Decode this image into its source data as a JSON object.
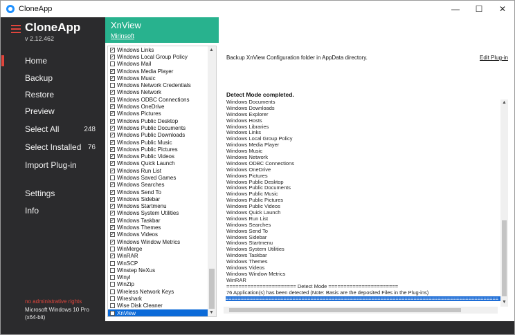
{
  "window": {
    "title": "CloneApp",
    "controls": {
      "minimize": "—",
      "maximize": "☐",
      "close": "✕"
    }
  },
  "sidebar": {
    "brand": "CloneApp",
    "version": "v 2.12.462",
    "items": [
      {
        "label": "Home",
        "count": ""
      },
      {
        "label": "Backup",
        "count": ""
      },
      {
        "label": "Restore",
        "count": ""
      },
      {
        "label": "Preview",
        "count": ""
      },
      {
        "label": "Select All",
        "count": "248"
      },
      {
        "label": "Select Installed",
        "count": "76"
      },
      {
        "label": "Import Plug-in",
        "count": ""
      },
      {
        "label": "Settings",
        "count": ""
      },
      {
        "label": "Info",
        "count": ""
      }
    ],
    "admin_note": "no administrative rights",
    "os_info": "Microsoft Windows 10 Pro (x64-bit)"
  },
  "plugin": {
    "title": "XnView",
    "author": "Mirinsoft",
    "description": "Backup XnView Configuration folder in AppData directory.",
    "edit_link": "Edit Plug-in"
  },
  "plugin_list": [
    {
      "label": "Windows Links",
      "checked": true
    },
    {
      "label": "Windows Local Group Policy",
      "checked": true
    },
    {
      "label": "Windows Mail",
      "checked": false
    },
    {
      "label": "Windows Media Player",
      "checked": true
    },
    {
      "label": "Windows Music",
      "checked": true
    },
    {
      "label": "Windows Network Credentials",
      "checked": false
    },
    {
      "label": "Windows Network",
      "checked": true
    },
    {
      "label": "Windows ODBC Connections",
      "checked": true
    },
    {
      "label": "Windows OneDrive",
      "checked": true
    },
    {
      "label": "Windows Pictures",
      "checked": true
    },
    {
      "label": "Windows Public Desktop",
      "checked": true
    },
    {
      "label": "Windows Public Documents",
      "checked": true
    },
    {
      "label": "Windows Public Downloads",
      "checked": true
    },
    {
      "label": "Windows Public Music",
      "checked": true
    },
    {
      "label": "Windows Public Pictures",
      "checked": true
    },
    {
      "label": "Windows Public Videos",
      "checked": true
    },
    {
      "label": "Windows Quick Launch",
      "checked": true
    },
    {
      "label": "Windows Run List",
      "checked": true
    },
    {
      "label": "Windows Saved Games",
      "checked": false
    },
    {
      "label": "Windows Searches",
      "checked": true
    },
    {
      "label": "Windows Send To",
      "checked": true
    },
    {
      "label": "Windows Sidebar",
      "checked": true
    },
    {
      "label": "Windows Startmenu",
      "checked": true
    },
    {
      "label": "Windows System Utilities",
      "checked": true
    },
    {
      "label": "Windows Taskbar",
      "checked": true
    },
    {
      "label": "Windows Themes",
      "checked": true
    },
    {
      "label": "Windows Videos",
      "checked": true
    },
    {
      "label": "Windows Window Metrics",
      "checked": true
    },
    {
      "label": "WinMerge",
      "checked": false
    },
    {
      "label": "WinRAR",
      "checked": true
    },
    {
      "label": "WinSCP",
      "checked": false
    },
    {
      "label": "Winstep NeXus",
      "checked": false
    },
    {
      "label": "Winyl",
      "checked": false
    },
    {
      "label": "WinZip",
      "checked": false
    },
    {
      "label": "Wireless Network Keys",
      "checked": false
    },
    {
      "label": "Wireshark",
      "checked": false
    },
    {
      "label": "Wise Disk Cleaner",
      "checked": false
    },
    {
      "label": "XnView",
      "checked": false,
      "selected": true
    }
  ],
  "log": {
    "title": "Detect Mode completed.",
    "lines": [
      "Windows Documents",
      "Windows Downloads",
      "Windows Explorer",
      "Windows Hosts",
      "Windows Libraries",
      "Windows Links",
      "Windows Local Group Policy",
      "Windows Media Player",
      "Windows Music",
      "Windows Network",
      "Windows ODBC Connections",
      "Windows OneDrive",
      "Windows Pictures",
      "Windows Public Desktop",
      "Windows Public Documents",
      "Windows Public Music",
      "Windows Public Pictures",
      "Windows Public Videos",
      "Windows Quick Launch",
      "Windows Run List",
      "Windows Searches",
      "Windows Send To",
      "Windows Sidebar",
      "Windows Startmenu",
      "Windows System Utilities",
      "Windows Taskbar",
      "Windows Themes",
      "Windows Videos",
      "Windows Window Metrics",
      "WinRAR",
      "======================= Detect Mode =======================",
      "76 Application(s) has been detected (Note: Basis are the deposited Files in the Plug-ins)",
      "=========================================================================================="
    ]
  },
  "colors": {
    "sidebar_bg": "#2b2b2d",
    "accent_red": "#e0453c",
    "header_green": "#28b28e",
    "selection_blue": "#0b6ad8"
  },
  "icons": {
    "app": "cloneapp-logo-icon",
    "menu": "hamburger-icon",
    "check": "checkmark-icon"
  }
}
